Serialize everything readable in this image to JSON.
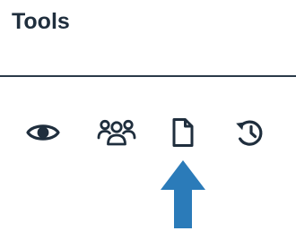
{
  "panel": {
    "title": "Tools"
  },
  "toolbar": {
    "items": [
      {
        "icon": "eye-icon"
      },
      {
        "icon": "users-icon"
      },
      {
        "icon": "document-icon"
      },
      {
        "icon": "history-icon"
      }
    ]
  },
  "annotation": {
    "icon": "up-arrow-icon",
    "color": "#2b7bb9"
  },
  "colors": {
    "text": "#1f2e3d",
    "icon": "#1f2e3d",
    "divider": "#2b3a49",
    "arrow": "#2b7bb9"
  }
}
